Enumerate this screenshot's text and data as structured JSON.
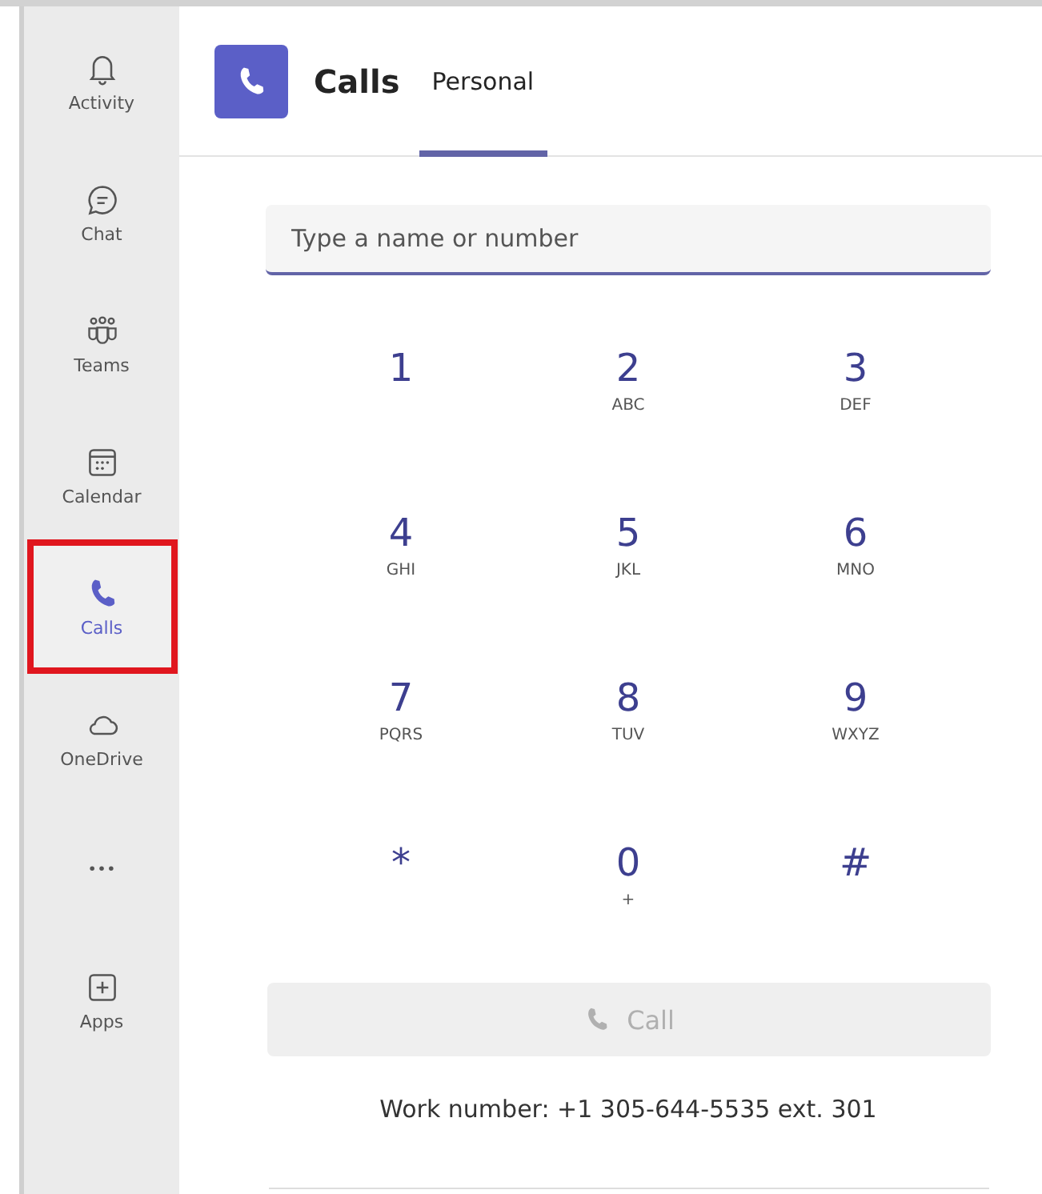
{
  "sidebar": {
    "items": [
      {
        "label": "Activity",
        "selected": false,
        "highlighted": false
      },
      {
        "label": "Chat",
        "selected": false,
        "highlighted": false
      },
      {
        "label": "Teams",
        "selected": false,
        "highlighted": false
      },
      {
        "label": "Calendar",
        "selected": false,
        "highlighted": false
      },
      {
        "label": "Calls",
        "selected": true,
        "highlighted": true
      },
      {
        "label": "OneDrive",
        "selected": false,
        "highlighted": false
      },
      {
        "selected": false,
        "highlighted": false
      },
      {
        "label": "Apps",
        "selected": false,
        "highlighted": false
      }
    ]
  },
  "header": {
    "title": "Calls",
    "tabs": [
      {
        "label": "Personal",
        "selected": true
      }
    ]
  },
  "dial_field": {
    "placeholder": "Type a name or number"
  },
  "keypad": [
    {
      "digit": "1"
    },
    {
      "digit": "2",
      "letters": "ABC"
    },
    {
      "digit": "3",
      "letters": "DEF"
    },
    {
      "digit": "4",
      "letters": "GHI"
    },
    {
      "digit": "5",
      "letters": "JKL"
    },
    {
      "digit": "6",
      "letters": "MNO"
    },
    {
      "digit": "7",
      "letters": "PQRS"
    },
    {
      "digit": "8",
      "letters": "TUV"
    },
    {
      "digit": "9",
      "letters": "WXYZ"
    },
    {
      "digit": "*"
    },
    {
      "digit": "0",
      "letters": "+"
    },
    {
      "digit": "#"
    }
  ],
  "call_button": {
    "label": "Call",
    "disabled": true
  },
  "work_number": "Work number: +1 305-644-5535 ext. 301"
}
